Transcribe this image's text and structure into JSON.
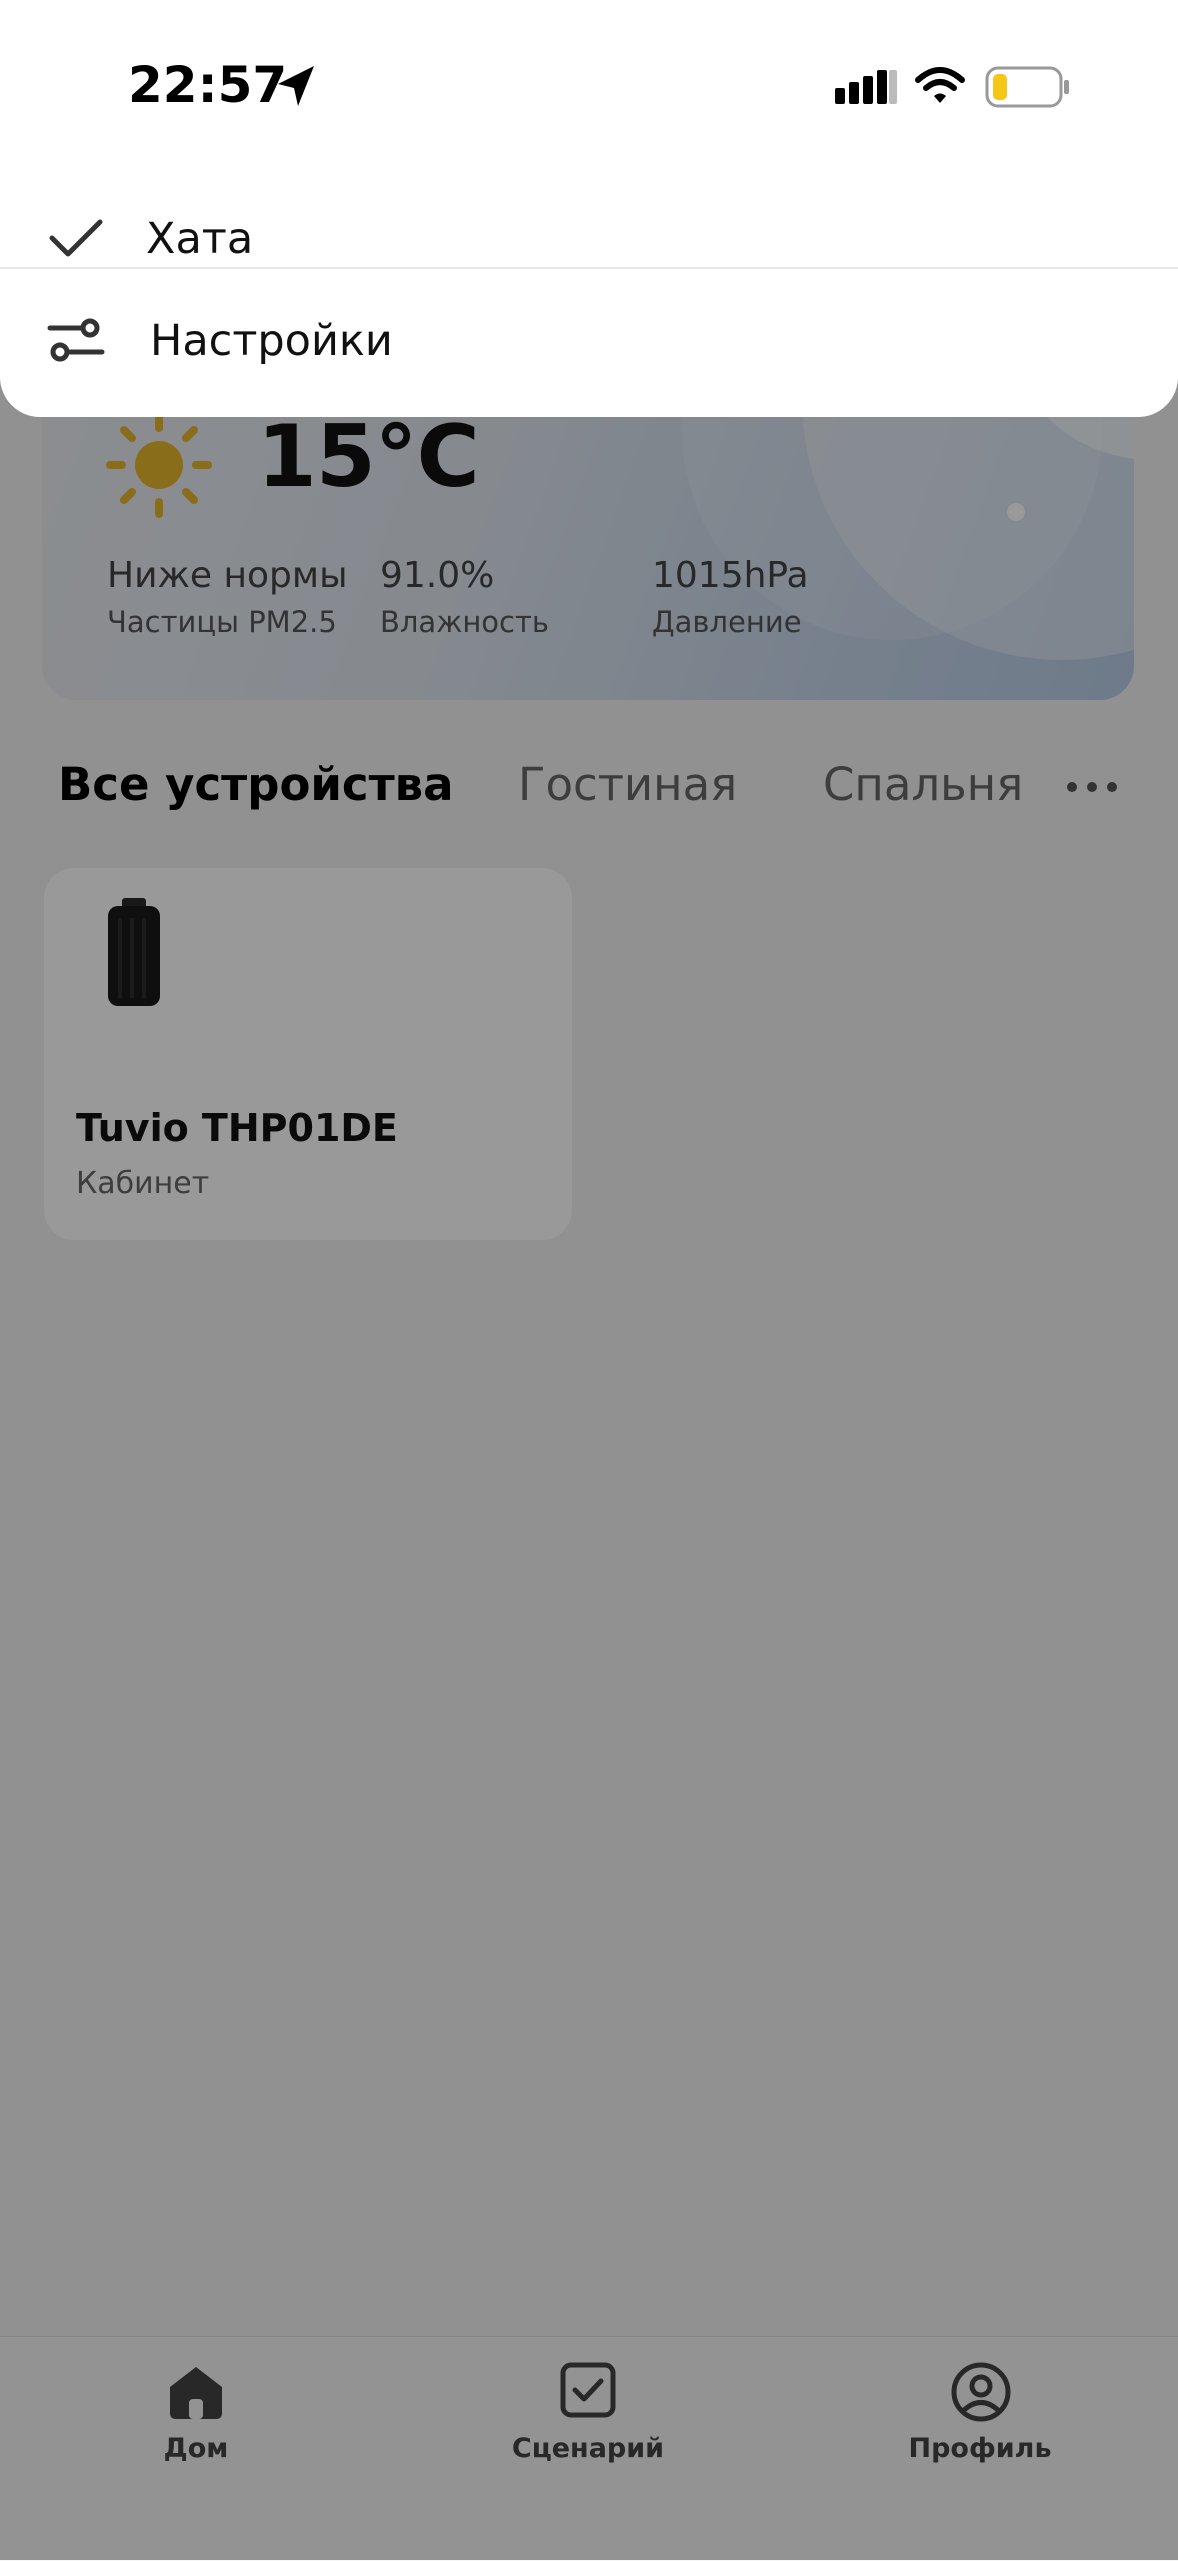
{
  "status_bar": {
    "time": "22:57"
  },
  "menu": {
    "items": [
      {
        "label": "Хата",
        "icon": "check-icon",
        "selected": true
      },
      {
        "label": "Настройки",
        "icon": "sliders-icon",
        "selected": false
      }
    ]
  },
  "weather": {
    "temperature": "15°C",
    "icon": "sun-icon",
    "stats": [
      {
        "value": "Ниже нормы",
        "label": "Частицы PM2.5"
      },
      {
        "value": "91.0%",
        "label": "Влажность"
      },
      {
        "value": "1015hPa",
        "label": "Давление"
      }
    ]
  },
  "tabs": [
    {
      "label": "Все устройства",
      "active": true
    },
    {
      "label": "Гостиная",
      "active": false
    },
    {
      "label": "Спальня",
      "active": false
    }
  ],
  "more_icon": "more-horizontal-icon",
  "devices": [
    {
      "name": "Tuvio THP01DE",
      "room": "Кабинет"
    }
  ],
  "bottom_nav": [
    {
      "label": "Дом",
      "icon": "home-icon"
    },
    {
      "label": "Сценарий",
      "icon": "checkbox-icon"
    },
    {
      "label": "Профиль",
      "icon": "user-circle-icon"
    }
  ],
  "colors": {
    "sun": "#e6b62e",
    "overlay": "rgba(0,0,0,0.40)",
    "battery_low": "#f5c518"
  }
}
